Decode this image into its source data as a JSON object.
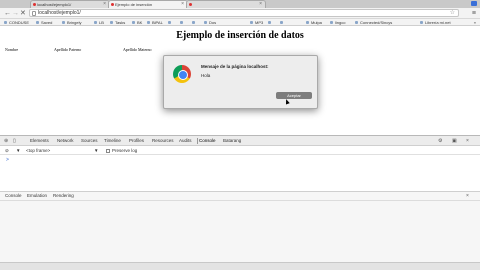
{
  "browser": {
    "tabs": [
      {
        "title": "localhost/ejemplo1/"
      },
      {
        "title": "Ejemplo de inserción"
      },
      {
        "title": ""
      }
    ],
    "url": "localhost/ejemplo1/",
    "back_label": "←",
    "forward_label": "→",
    "reload_label": "✕",
    "home_label": "⌂",
    "menu_label": "≡",
    "star_label": "☆",
    "close_tab_label": "×"
  },
  "bookmarks": {
    "items": [
      "CONDUSE",
      "Saved",
      "Bringely",
      "LB",
      "Tasks",
      "BK",
      "BiPAL",
      "",
      "",
      "",
      "Dos",
      "MP3",
      "",
      "",
      "Mulpa",
      "lingco",
      "Connected/Sincys",
      "Librería mi.net"
    ],
    "other": "»"
  },
  "page": {
    "title": "Ejemplo de inserción de datos",
    "columns": [
      "Nombre",
      "Apellido Paterno",
      "Apellido Materno"
    ]
  },
  "dialog": {
    "title": "Mensaje de la página localhost:",
    "message": "Hola",
    "accept_label": "Aceptar"
  },
  "devtools": {
    "tabs": [
      "Elements",
      "Network",
      "Sources",
      "Timeline",
      "Profiles",
      "Resources",
      "Audits",
      "Console",
      "Batarang"
    ],
    "active_tab": "Console",
    "frame_select": "<top frame>",
    "preserve_log_label": "Preserve log",
    "prompt": ">",
    "drawer_tabs": [
      "Console",
      "Emulation",
      "Rendering"
    ],
    "icons": {
      "inspect": "⊕",
      "device": "▯",
      "clear": "⊘",
      "filter": "▼",
      "settings": "⚙",
      "dock": "▣",
      "close": "×"
    }
  },
  "colors": {
    "accept_button": "#7d7d7d",
    "console_prompt": "#3366cc"
  }
}
